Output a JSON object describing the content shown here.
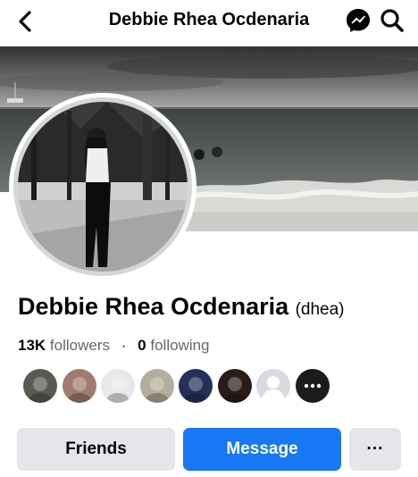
{
  "header": {
    "title": "Debbie Rhea Ocdenaria",
    "back_icon": "back-arrow-icon",
    "messenger_icon": "messenger-icon",
    "search_icon": "search-icon"
  },
  "profile": {
    "name": "Debbie Rhea Ocdenaria",
    "alternate_name": "(dhea)",
    "followers_count": "13K",
    "followers_label": "followers",
    "separator": "·",
    "following_count": "0",
    "following_label": "following"
  },
  "follower_previews": [
    {
      "shade": "#5a5a52"
    },
    {
      "shade": "#a07c70"
    },
    {
      "shade": "#e8e8e8"
    },
    {
      "shade": "#b5ad9c"
    },
    {
      "shade": "#24305a"
    },
    {
      "shade": "#2a1d18"
    },
    {
      "shade": "#d8dadf",
      "placeholder": true
    },
    {
      "shade": "#1c1c1c",
      "more": true
    }
  ],
  "actions": {
    "friends_label": "Friends",
    "message_label": "Message",
    "more_label": "···"
  },
  "colors": {
    "accent": "#1877f2",
    "secondary_button": "#e4e6eb",
    "muted_text": "#65676b"
  }
}
